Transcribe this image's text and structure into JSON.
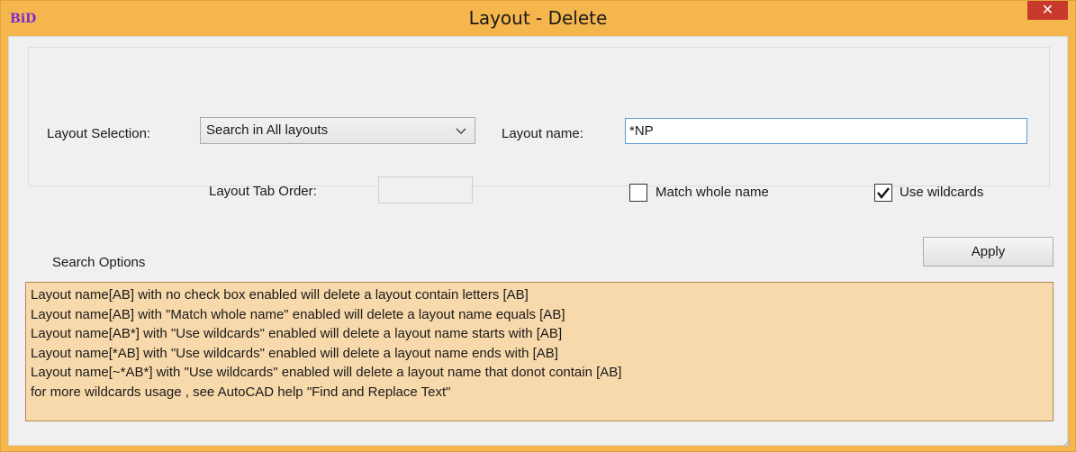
{
  "window": {
    "app_icon_text": "BiD",
    "title": "Layout - Delete",
    "close_glyph": "✕"
  },
  "form": {
    "layout_selection_label": "Layout Selection:",
    "layout_selection_value": "Search in All layouts",
    "layout_name_label": "Layout name:",
    "layout_name_value": "*NP",
    "tab_order_label": "Layout Tab Order:",
    "match_whole_name_label": "Match whole name",
    "match_whole_name_checked": false,
    "use_wildcards_label": "Use wildcards",
    "use_wildcards_checked": true
  },
  "search_options": {
    "label": "Search Options",
    "apply_label": "Apply",
    "lines": [
      "Layout name[AB] with no check box enabled will delete a layout contain letters [AB]",
      "Layout name[AB] with \"Match whole name\" enabled will delete a layout name equals [AB]",
      "Layout name[AB*] with \"Use wildcards\" enabled will delete a layout name starts with [AB]",
      "Layout name[*AB] with \"Use wildcards\" enabled will delete a layout name ends with [AB]",
      "Layout name[~*AB*] with \"Use wildcards\" enabled will delete a layout name that donot contain [AB]",
      "for more wildcards usage , see AutoCAD help  \"Find and Replace Text\""
    ]
  },
  "colors": {
    "title_bar": "#f5b64d",
    "close_button": "#c7392b",
    "options_background": "#f8d9ab"
  },
  "icons": {
    "dropdown": "chevron-down-icon",
    "checkmark": "checkmark-icon",
    "resize": "resize-grip-icon"
  }
}
